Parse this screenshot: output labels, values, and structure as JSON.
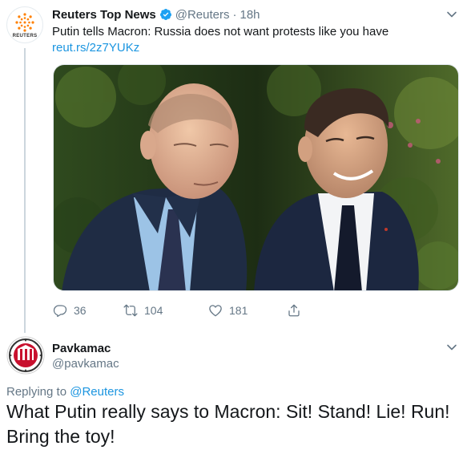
{
  "tweet": {
    "avatar_text": "REUTERS",
    "author_name": "Reuters Top News",
    "handle": "@Reuters",
    "separator": "·",
    "time": "18h",
    "text": "Putin tells Macron: Russia does not want protests like you have",
    "link": "reut.rs/2z7YUKz",
    "actions": {
      "replies": "36",
      "retweets": "104",
      "likes": "181"
    }
  },
  "reply": {
    "author_name": "Pavkamac",
    "handle": "@pavkamac",
    "replying_prefix": "Replying to ",
    "replying_to": "@Reuters",
    "text": "What Putin really says to Macron: Sit! Stand! Lie! Run! Bring the toy!"
  },
  "colors": {
    "link": "#1b95e0",
    "muted": "#657786",
    "text": "#14171a",
    "reuters_orange": "#ff8000",
    "verified_blue": "#1da1f2"
  },
  "icons": [
    "reuters-logo",
    "verified-badge-icon",
    "chevron-down-icon",
    "reply-icon",
    "retweet-icon",
    "like-icon",
    "share-icon"
  ]
}
